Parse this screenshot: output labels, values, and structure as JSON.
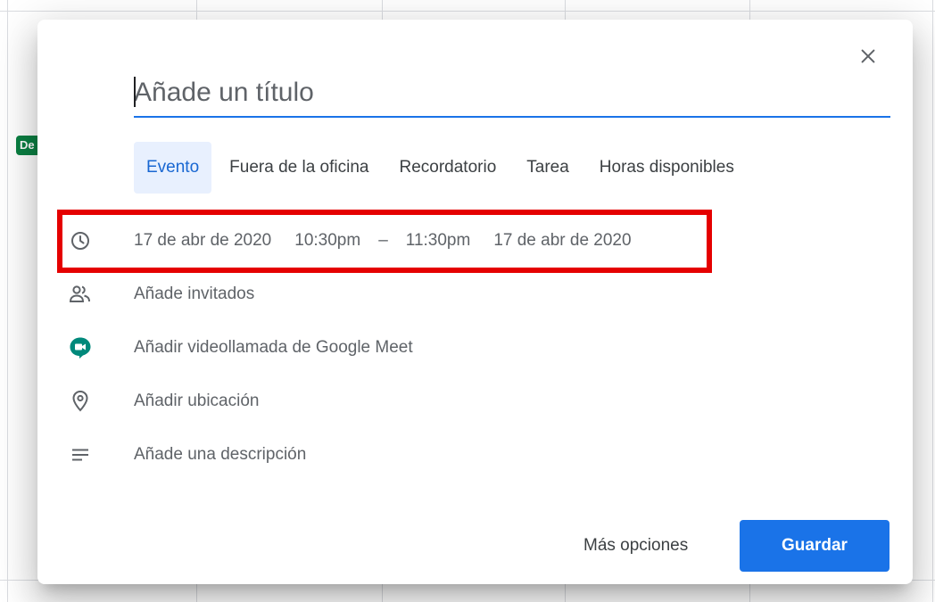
{
  "background": {
    "chip_label": "De"
  },
  "dialog": {
    "title_placeholder": "Añade un título",
    "tabs": [
      {
        "label": "Evento",
        "active": true
      },
      {
        "label": "Fuera de la oficina",
        "active": false
      },
      {
        "label": "Recordatorio",
        "active": false
      },
      {
        "label": "Tarea",
        "active": false
      },
      {
        "label": "Horas disponibles",
        "active": false
      }
    ],
    "datetime": {
      "start_date": "17 de abr de 2020",
      "start_time": "10:30pm",
      "separator": "–",
      "end_time": "11:30pm",
      "end_date": "17 de abr de 2020"
    },
    "rows": {
      "guests": "Añade invitados",
      "meet": "Añadir videollamada de Google Meet",
      "location": "Añadir ubicación",
      "description": "Añade una descripción"
    },
    "footer": {
      "more_options": "Más opciones",
      "save": "Guardar"
    }
  },
  "colors": {
    "accent": "#1a73e8",
    "active_tab_bg": "#e8f0fe",
    "highlight_box": "#e50000",
    "meet_green": "#00897b"
  },
  "icons": [
    "close-icon",
    "clock-icon",
    "people-icon",
    "google-meet-icon",
    "location-pin-icon",
    "description-lines-icon"
  ]
}
